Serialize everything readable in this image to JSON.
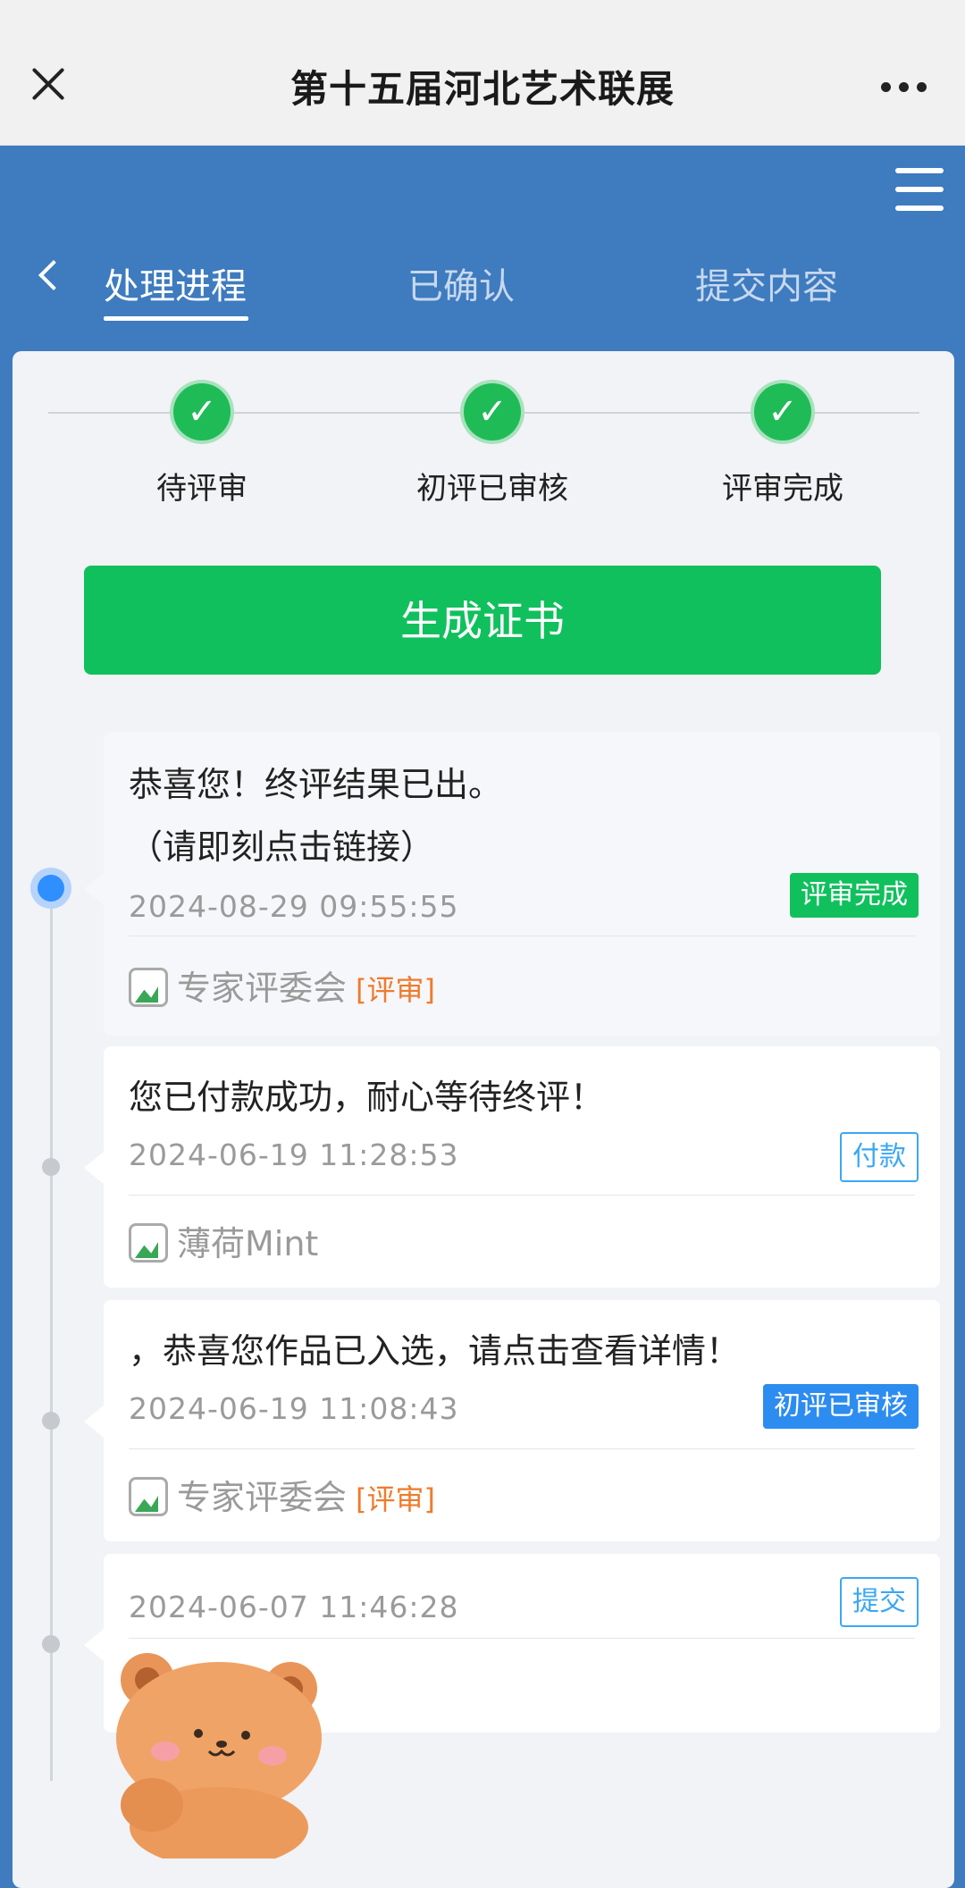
{
  "topbar": {
    "title": "第十五届河北艺术联展"
  },
  "tabs": [
    {
      "label": "处理进程"
    },
    {
      "label": "已确认"
    },
    {
      "label": "提交内容"
    }
  ],
  "steps": [
    {
      "label": "待评审"
    },
    {
      "label": "初评已审核"
    },
    {
      "label": "评审完成"
    }
  ],
  "cert_button": "生成证书",
  "timeline": [
    {
      "line1": "恭喜您！终评结果已出。",
      "line2": "（请即刻点击链接）",
      "time": "2024-08-29 09:55:55",
      "badge": "评审完成",
      "author": "专家评委会",
      "role": "[评审]"
    },
    {
      "line1": "您已付款成功，耐心等待终评！",
      "time": "2024-06-19 11:28:53",
      "badge": "付款",
      "author": "薄荷Mint"
    },
    {
      "line1": "，恭喜您作品已入选，请点击查看详情！",
      "time": "2024-06-19 11:08:43",
      "badge": "初评已审核",
      "author": "专家评委会",
      "role": "[评审]"
    },
    {
      "time": "2024-06-07 11:46:28",
      "badge": "提交"
    }
  ],
  "colors": {
    "header_blue": "#3e7bbf",
    "success_green": "#10c05d",
    "badge_blue": "#2d8cf0",
    "role_orange": "#f07a2b"
  }
}
